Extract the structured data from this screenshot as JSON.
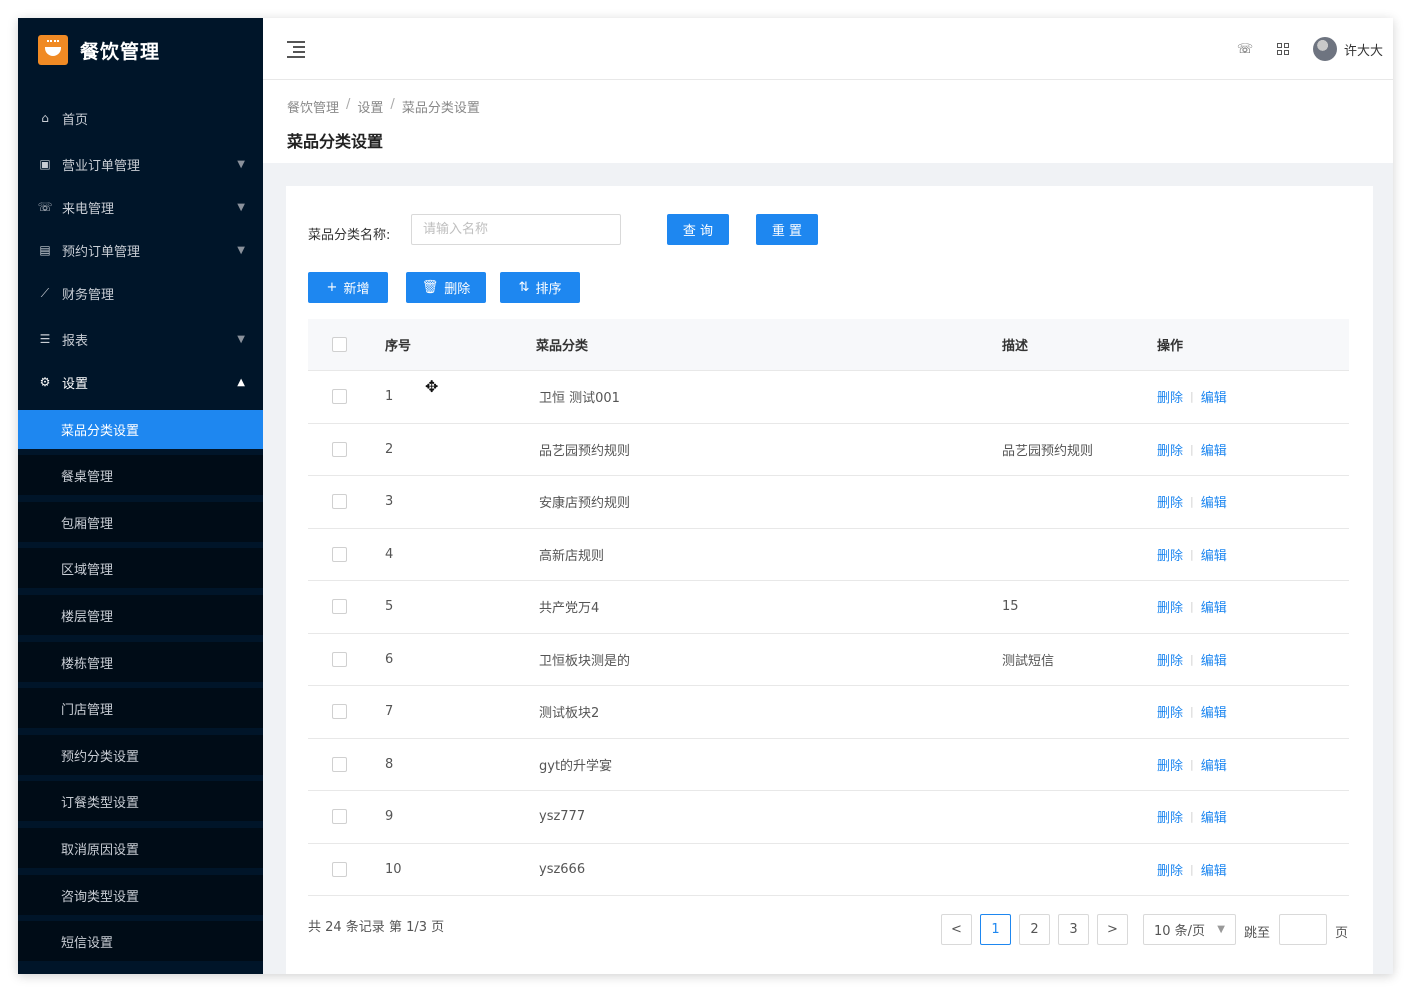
{
  "app": {
    "name": "餐饮管理"
  },
  "sidebar": {
    "items": [
      {
        "label": "首页",
        "icon": "home-icon",
        "glyph": "⌂",
        "has_arrow": false
      },
      {
        "label": "营业订单管理",
        "icon": "calendar-icon",
        "glyph": "▣",
        "has_arrow": true
      },
      {
        "label": "来电管理",
        "icon": "phone-icon",
        "glyph": "☏",
        "has_arrow": true
      },
      {
        "label": "预约订单管理",
        "icon": "document-icon",
        "glyph": "▤",
        "has_arrow": true
      },
      {
        "label": "财务管理",
        "icon": "chart-icon",
        "glyph": "⟋",
        "has_arrow": false
      },
      {
        "label": "报表",
        "icon": "menu-list-icon",
        "glyph": "☰",
        "has_arrow": true
      },
      {
        "label": "设置",
        "icon": "gear-icon",
        "glyph": "⚙",
        "has_arrow": true,
        "open": true
      }
    ],
    "sub_items": [
      {
        "label": "菜品分类设置",
        "active": true
      },
      {
        "label": "餐桌管理"
      },
      {
        "label": "包厢管理"
      },
      {
        "label": "区域管理"
      },
      {
        "label": "楼层管理"
      },
      {
        "label": "楼栋管理"
      },
      {
        "label": "门店管理"
      },
      {
        "label": "预约分类设置"
      },
      {
        "label": "订餐类型设置"
      },
      {
        "label": "取消原因设置"
      },
      {
        "label": "咨询类型设置"
      },
      {
        "label": "短信设置"
      }
    ]
  },
  "header": {
    "username": "许大大"
  },
  "breadcrumb": [
    "餐饮管理",
    "设置",
    "菜品分类设置"
  ],
  "page": {
    "title": "菜品分类设置"
  },
  "search": {
    "label": "菜品分类名称:",
    "placeholder": "请输入名称",
    "value": "",
    "query_label": "查 询",
    "reset_label": "重 置"
  },
  "toolbar": {
    "add_label": "新增",
    "delete_label": "删除",
    "sort_label": "排序"
  },
  "table": {
    "columns": [
      "序号",
      "菜品分类",
      "描述",
      "操作"
    ],
    "rows": [
      {
        "no": "1",
        "category": "卫恒 测试001",
        "desc": ""
      },
      {
        "no": "2",
        "category": "品艺园预约规则",
        "desc": "品艺园预约规则"
      },
      {
        "no": "3",
        "category": "安康店预约规则",
        "desc": ""
      },
      {
        "no": "4",
        "category": "高新店规则",
        "desc": ""
      },
      {
        "no": "5",
        "category": "共产党万4",
        "desc": "15"
      },
      {
        "no": "6",
        "category": "卫恒板块测是的",
        "desc": "测試短信"
      },
      {
        "no": "7",
        "category": "测试板块2",
        "desc": ""
      },
      {
        "no": "8",
        "category": "gyt的升学宴",
        "desc": ""
      },
      {
        "no": "9",
        "category": "ysz777",
        "desc": ""
      },
      {
        "no": "10",
        "category": "ysz666",
        "desc": ""
      }
    ],
    "op_delete": "删除",
    "op_edit": "编辑"
  },
  "pagination": {
    "total_text": "共 24 条记录 第 1/3 页",
    "prev": "<",
    "next": ">",
    "pages": [
      "1",
      "2",
      "3"
    ],
    "current": "1",
    "page_size": "10 条/页",
    "jump_label": "跳至",
    "jump_unit": "页"
  }
}
